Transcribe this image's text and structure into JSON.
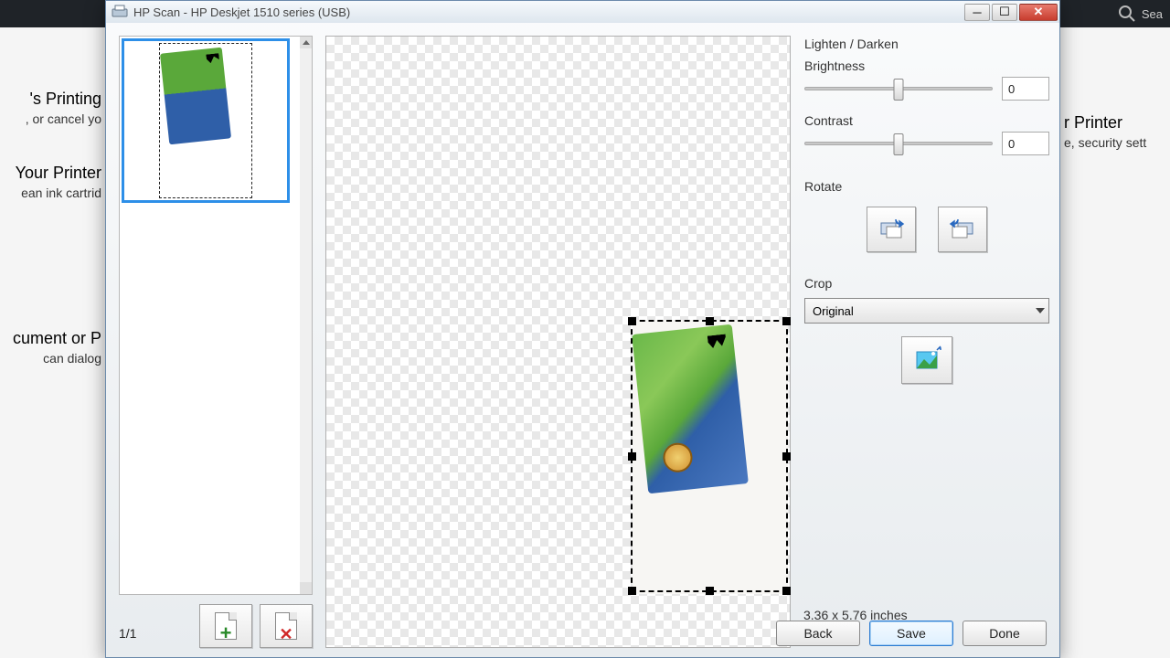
{
  "window": {
    "title": "HP Scan - HP Deskjet 1510 series (USB)"
  },
  "background": {
    "left": {
      "h1": "'s Printing",
      "p1": ", or cancel yo",
      "h2": "Your Printer",
      "p2": "ean ink cartrid",
      "h3": "cument or P",
      "p3": "can dialog"
    },
    "right": {
      "h1": "r Printer",
      "p1": "e, security sett"
    },
    "search_placeholder": "Sea"
  },
  "thumbs": {
    "page_info": "1/1"
  },
  "panel": {
    "lighten_title": "Lighten / Darken",
    "brightness_label": "Brightness",
    "brightness_value": "0",
    "contrast_label": "Contrast",
    "contrast_value": "0",
    "rotate_title": "Rotate",
    "crop_title": "Crop",
    "crop_selected": "Original",
    "dimensions": "3.36 x 5.76 inches"
  },
  "footer": {
    "back": "Back",
    "save": "Save",
    "done": "Done"
  }
}
